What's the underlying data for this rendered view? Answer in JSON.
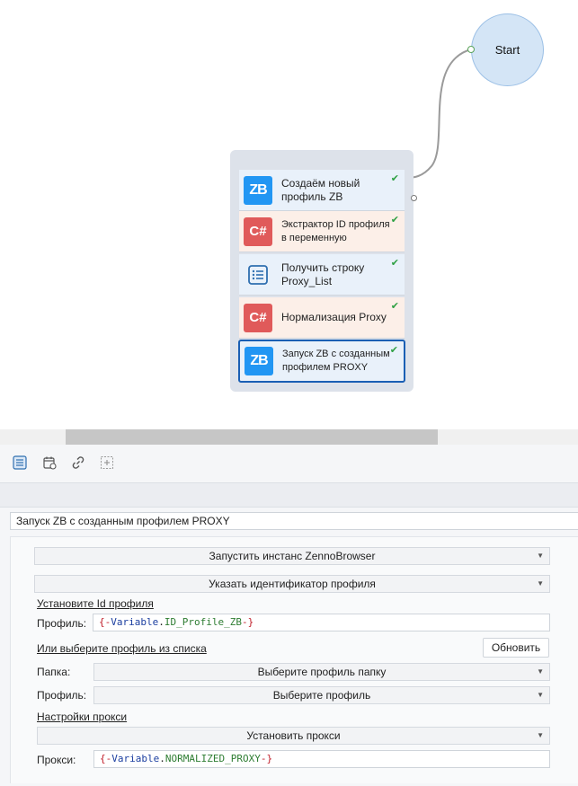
{
  "canvas": {
    "start_label": "Start",
    "blocks": [
      {
        "line1": "Создаём новый",
        "line2": "профиль ZB",
        "icon": "ZB",
        "icon_type": "zennobrowser-icon",
        "status": "✔"
      },
      {
        "line1": "Экстрактор ID профиля",
        "line2": "в переменную",
        "icon": "C#",
        "icon_type": "csharp-icon",
        "status": "✔"
      },
      {
        "line1": "Получить строку",
        "line2": "Proxy_List",
        "icon": "",
        "icon_type": "list-icon",
        "status": "✔"
      },
      {
        "line1": "Нормализация Proxy",
        "line2": "",
        "icon": "C#",
        "icon_type": "csharp-icon",
        "status": "✔"
      },
      {
        "line1": "Запуск ZB с созданным",
        "line2": "профилем PROXY",
        "icon": "ZB",
        "icon_type": "zennobrowser-icon",
        "status": "✔"
      }
    ],
    "colors": {
      "zb": "#2196f3",
      "csharp": "#e05a5a",
      "ok": "#2ea043",
      "selected": "#1a5fb4"
    }
  },
  "panel": {
    "block_name": "Запуск ZB с созданным профилем PROXY",
    "action_select": "Запустить инстанс ZennoBrowser",
    "mode_select": "Указать идентификатор профиля",
    "set_id_link": "Установите Id профиля",
    "profile_label": "Профиль:",
    "profile_value": {
      "open": "{-",
      "kw": "Variable",
      "dot": ".",
      "name": "ID_Profile_ZB",
      "close": "-}"
    },
    "choose_link": "Или выберите профиль из списка",
    "refresh_button": "Обновить",
    "folder_label": "Папка:",
    "folder_select": "Выберите профиль папку",
    "profile2_label": "Профиль:",
    "profile_select": "Выберите профиль",
    "proxy_settings_link": "Настройки прокси",
    "proxy_select": "Установить прокси",
    "proxy_label": "Прокси:",
    "proxy_value": {
      "open": "{-",
      "kw": "Variable",
      "dot": ".",
      "name": "NORMALIZED_PROXY",
      "close": "-}"
    }
  }
}
